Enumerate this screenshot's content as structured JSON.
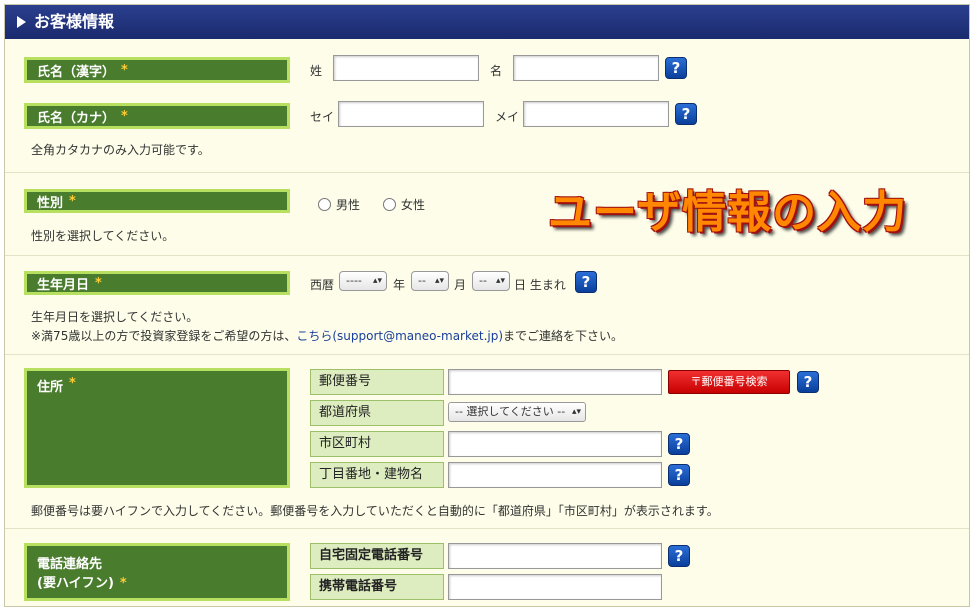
{
  "section_title": "お客様情報",
  "banner_text": "ユーザ情報の入力",
  "required_mark": "*",
  "help_glyph": "?",
  "name_kanji": {
    "label": "氏名（漢字）",
    "last_label": "姓",
    "first_label": "名",
    "last_value": "",
    "first_value": ""
  },
  "name_kana": {
    "label": "氏名（カナ）",
    "last_label": "セイ",
    "first_label": "メイ",
    "last_value": "",
    "first_value": "",
    "note": "全角カタカナのみ入力可能です。"
  },
  "gender": {
    "label": "性別",
    "options": [
      "男性",
      "女性"
    ],
    "note": "性別を選択してください。"
  },
  "birthdate": {
    "label": "生年月日",
    "era_label": "西暦",
    "year_value": "----",
    "year_suffix": "年",
    "month_value": "--",
    "month_suffix": "月",
    "day_value": "--",
    "day_suffix": "日 生まれ",
    "note1": "生年月日を選択してください。",
    "note2_prefix": "※満75歳以上の方で投資家登録をご希望の方は、",
    "note2_link": "こちら(support@maneo-market.jp)",
    "note2_suffix": "までご連絡を下さい。"
  },
  "address": {
    "label": "住所",
    "postal_label": "郵便番号",
    "postal_value": "",
    "postal_search_button": "〒郵便番号検索",
    "prefecture_label": "都道府県",
    "prefecture_select": "-- 選択してください --",
    "city_label": "市区町村",
    "city_value": "",
    "street_label": "丁目番地・建物名",
    "street_value": "",
    "note": "郵便番号は要ハイフンで入力してください。郵便番号を入力していただくと自動的に「都道府県」「市区町村」が表示されます。"
  },
  "phone": {
    "label_line1": "電話連絡先",
    "label_line2": "(要ハイフン)",
    "home_label": "自宅固定電話番号",
    "home_value": "",
    "mobile_label": "携帯電話番号",
    "mobile_value": ""
  },
  "colors": {
    "header": "#1f3180",
    "label_bg": "#4a7c2e",
    "label_border": "#b8e060",
    "asterisk": "#ffcc33",
    "sublabel_bg": "#ddedc0",
    "search_button": "#e01010",
    "help_button": "#1a5cc4",
    "banner_text": "#ff8800",
    "page_bg": "#fdfde9"
  }
}
